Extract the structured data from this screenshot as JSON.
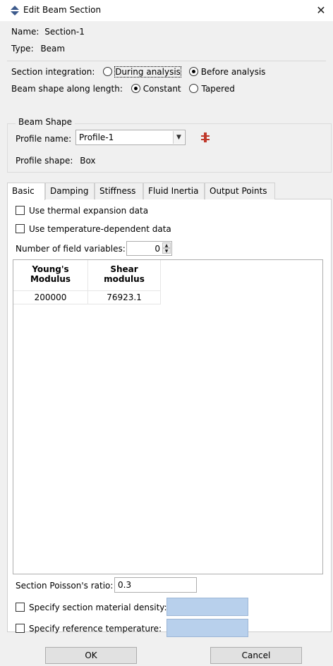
{
  "window": {
    "title": "Edit Beam Section",
    "close_glyph": "✕"
  },
  "name": {
    "label": "Name:",
    "value": "Section-1"
  },
  "type": {
    "label": "Type:",
    "value": "Beam"
  },
  "section_integration": {
    "label": "Section integration:",
    "options": [
      "During analysis",
      "Before analysis"
    ],
    "selected": "Before analysis"
  },
  "beam_shape": {
    "label": "Beam shape along length:",
    "options": [
      "Constant",
      "Tapered"
    ],
    "selected": "Constant"
  },
  "beam_shape_group": {
    "title": "Beam Shape",
    "profile_name_label": "Profile name:",
    "profile_name_value": "Profile-1",
    "profile_shape_label": "Profile shape:",
    "profile_shape_value": "Box"
  },
  "tabs": [
    "Basic",
    "Damping",
    "Stiffness",
    "Fluid Inertia",
    "Output Points"
  ],
  "active_tab": "Basic",
  "basic": {
    "use_thermal": "Use thermal expansion data",
    "use_temp_dependent": "Use temperature-dependent data",
    "num_field_vars_label": "Number of field variables:",
    "num_field_vars_value": "0",
    "table": {
      "headers": [
        [
          "Young's",
          "Modulus"
        ],
        [
          "Shear",
          "modulus"
        ]
      ],
      "rows": [
        [
          "200000",
          "76923.1"
        ]
      ]
    },
    "poisson_label": "Section Poisson's ratio:",
    "poisson_value": "0.3",
    "density_label": "Specify section material density:",
    "ref_temp_label": "Specify reference temperature:"
  },
  "buttons": {
    "ok": "OK",
    "cancel": "Cancel"
  },
  "colors": {
    "disabled_field": "#b8d0ec",
    "title_icon": "#3c5a8c",
    "profile_icon": "#c0392b"
  }
}
